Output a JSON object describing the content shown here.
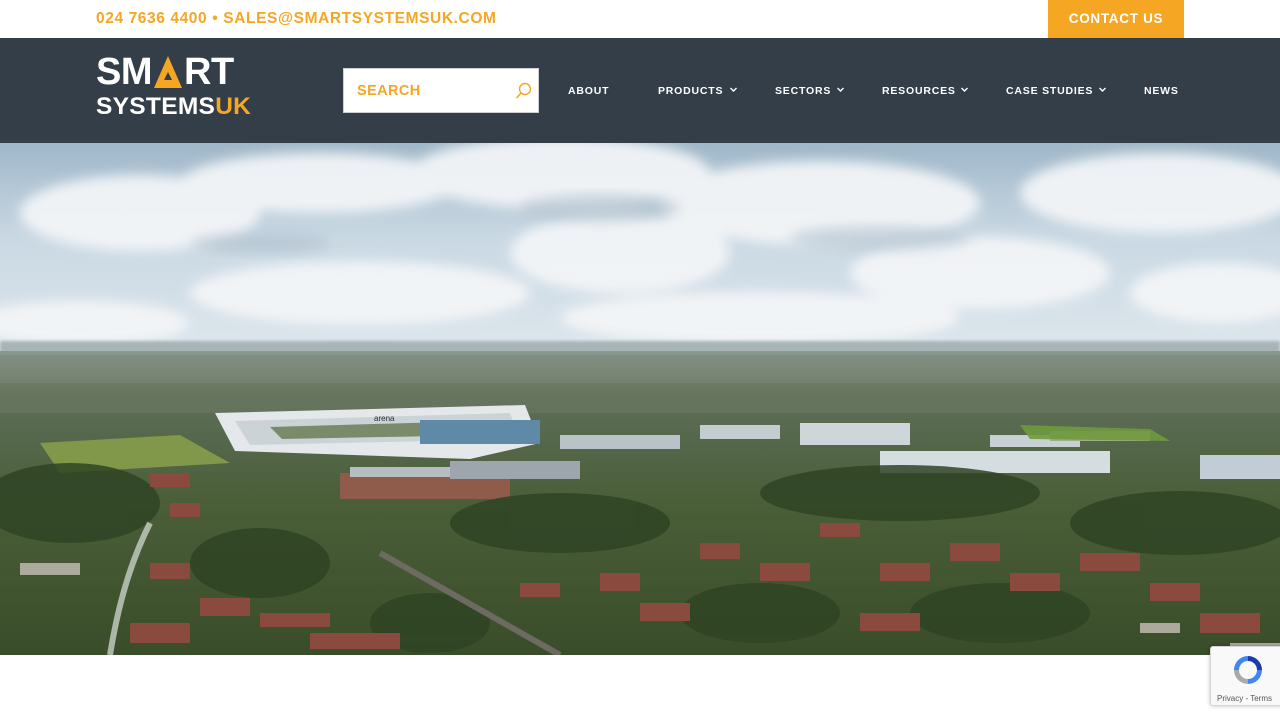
{
  "topbar": {
    "phone": "024 7636 4400",
    "separator": "•",
    "email": "SALES@SMARTSYSTEMSUK.COM",
    "contact_button": "CONTACT US"
  },
  "logo": {
    "line1_left": "SM",
    "line1_right": "RT",
    "line2_left": "SYSTEMS",
    "line2_right": "UK"
  },
  "search": {
    "placeholder": "SEARCH"
  },
  "nav": {
    "items": [
      {
        "label": "ABOUT",
        "has_dropdown": false
      },
      {
        "label": "PRODUCTS",
        "has_dropdown": true
      },
      {
        "label": "SECTORS",
        "has_dropdown": true
      },
      {
        "label": "RESOURCES",
        "has_dropdown": true
      },
      {
        "label": "CASE STUDIES",
        "has_dropdown": true
      },
      {
        "label": "NEWS",
        "has_dropdown": false
      }
    ]
  },
  "hero": {
    "stadium_sign": "arena"
  },
  "recaptcha": {
    "privacy": "Privacy",
    "separator": " - ",
    "terms": "Terms"
  },
  "colors": {
    "accent": "#f5a623",
    "header_bg": "#333e48",
    "white": "#ffffff"
  },
  "icons": {
    "search": "search-icon",
    "dropdown": "chevron-down-icon",
    "logo_triangle": "triangle-icon",
    "recaptcha": "recaptcha-icon"
  }
}
